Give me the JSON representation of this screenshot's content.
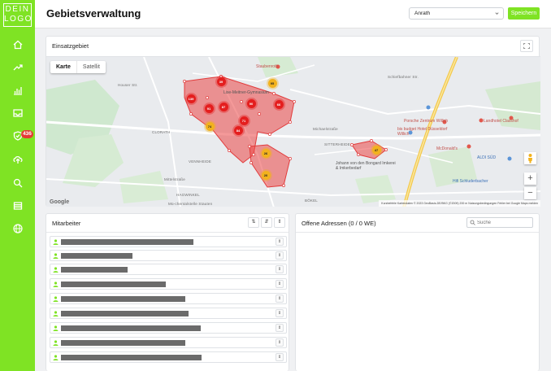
{
  "app": {
    "logo_line1": "DEIN",
    "logo_line2": "LOGO",
    "brand_color": "#7fe324"
  },
  "sidebar": {
    "items": [
      {
        "name": "home-icon"
      },
      {
        "name": "trend-icon"
      },
      {
        "name": "bar-chart-icon"
      },
      {
        "name": "inbox-icon"
      },
      {
        "name": "shield-check-icon"
      },
      {
        "name": "upload-icon"
      },
      {
        "name": "search-icon"
      },
      {
        "name": "list-icon"
      },
      {
        "name": "globe-icon"
      }
    ],
    "badge_count": "436"
  },
  "header": {
    "title": "Gebietsverwaltung",
    "select_value": "Anrath",
    "save_label": "Speichern"
  },
  "map_card": {
    "title": "Einsatzgebiet",
    "map_type_map": "Karte",
    "map_type_satellite": "Satellit",
    "google": "Google",
    "attribution": "Kurzbefehle   Kartendaten © 2023 GeoBasis-DE/BKG (©2009)   200 m   Nutzungsbedingungen   Fehler bei Google Maps melden",
    "labels": {
      "clorath": "CLORATH",
      "vennheide": "VENNHEIDE",
      "hagwinkel": "HAGWINKEL",
      "sitterheide": "SITTERHEIDE",
      "bokel": "BÖKEL",
      "michaelstraße": "Michaelstraße",
      "schiefbahn": "Schiefbahner Str.",
      "houser": "Houser Str.",
      "michel": "Mittelstraße",
      "staufen": "Mü-chentalstelle Stauten"
    },
    "pois": {
      "staubenroth": "Staubenroth",
      "gymnasium": "Lise-Meitner-Gymnasium",
      "porsche": "Porsche Zentrum Willich",
      "budget_hotel": "bis budget Hotel Düsseldorf Willich",
      "landhotel": "Landhotel Classhof",
      "mcdonalds": "McDonald's",
      "aldi": "ALDI SÜD",
      "hifi": "Hifi Schluderbacher",
      "imkerei": "Johann von den Bongard Imkerei & Imkerbedarf"
    },
    "clusters": [
      {
        "label": "39",
        "color": "red"
      },
      {
        "label": "95",
        "color": "yellow"
      },
      {
        "label": "139",
        "color": "red"
      },
      {
        "label": "87",
        "color": "red"
      },
      {
        "label": "90",
        "color": "red"
      },
      {
        "label": "66",
        "color": "red"
      },
      {
        "label": "91",
        "color": "red"
      },
      {
        "label": "71",
        "color": "red"
      },
      {
        "label": "74",
        "color": "yellow"
      },
      {
        "label": "84",
        "color": "red"
      },
      {
        "label": "26",
        "color": "yellow"
      },
      {
        "label": "20",
        "color": "yellow"
      },
      {
        "label": "47",
        "color": "yellow"
      }
    ]
  },
  "staff_card": {
    "title": "Mitarbeiter",
    "sort_asc": "⇅",
    "sort_desc": "⇵",
    "toggle": "⇕",
    "rows": [
      {
        "action": "⇕"
      },
      {
        "action": "⇕"
      },
      {
        "action": "⇕"
      },
      {
        "action": "⇕"
      },
      {
        "action": "⇕"
      },
      {
        "action": "⇕"
      },
      {
        "action": "⇕"
      },
      {
        "action": "⇕"
      },
      {
        "action": "⇕"
      }
    ]
  },
  "address_card": {
    "title": "Offene Adressen (0 / 0 WE)",
    "search_placeholder": "Suche"
  }
}
